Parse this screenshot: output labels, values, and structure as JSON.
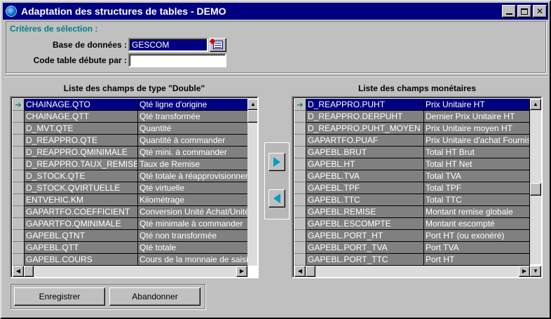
{
  "window": {
    "title": "Adaptation des structures de tables - DEMO",
    "min_glyph": "_",
    "max_glyph": "□",
    "close_glyph": "✕"
  },
  "criteria": {
    "title": "Critères de sélection :",
    "db_label": "Base de données :",
    "db_value": "GESCOM",
    "code_label": "Code table débute par :",
    "code_value": ""
  },
  "left_list": {
    "title": "Liste des champs de type \"Double\"",
    "selected_index": 0,
    "rows": [
      {
        "field": "CHAINAGE.QTO",
        "desc": "Qté ligne d'origine"
      },
      {
        "field": "CHAINAGE.QTT",
        "desc": "Qté transformée"
      },
      {
        "field": "D_MVT.QTE",
        "desc": "Quantité"
      },
      {
        "field": "D_REAPPRO.QTE",
        "desc": "Quantité à commander"
      },
      {
        "field": "D_REAPPRO.QMINIMALE",
        "desc": "Qté mini. à commander"
      },
      {
        "field": "D_REAPPRO.TAUX_REMISE",
        "desc": "Taux de Remise"
      },
      {
        "field": "D_STOCK.QTE",
        "desc": "Qté totale à réapprovisionner"
      },
      {
        "field": "D_STOCK.QVIRTUELLE",
        "desc": "Qté virtuelle"
      },
      {
        "field": "ENTVEHIC.KM",
        "desc": "Kilométrage"
      },
      {
        "field": "GAPARTFO.COEFFICIENT",
        "desc": "Conversion Unité Achat/Unité"
      },
      {
        "field": "GAPARTFO.QMINIMALE",
        "desc": "Qté minimale à commander"
      },
      {
        "field": "GAPEBL.QTNT",
        "desc": "Qté non transformée"
      },
      {
        "field": "GAPEBL.QTT",
        "desc": "Qté totale"
      },
      {
        "field": "GAPEBL.COURS",
        "desc": "Cours de la monnaie de saisie"
      }
    ]
  },
  "right_list": {
    "title": "Liste des champs monétaires",
    "selected_index": 0,
    "rows": [
      {
        "field": "D_REAPPRO.PUHT",
        "desc": "Prix Unitaire HT"
      },
      {
        "field": "D_REAPPRO.DERPUHT",
        "desc": "Dernier Prix Unitaire HT"
      },
      {
        "field": "D_REAPPRO.PUHT_MOYEN",
        "desc": "Prix Unitaire moyen HT"
      },
      {
        "field": "GAPARTFO.PUAF",
        "desc": "Prix Unitaire d'achat Fournisseur"
      },
      {
        "field": "GAPEBL.BRUT",
        "desc": "Total HT Brut"
      },
      {
        "field": "GAPEBL.HT",
        "desc": "Total HT Net"
      },
      {
        "field": "GAPEBL.TVA",
        "desc": "Total TVA"
      },
      {
        "field": "GAPEBL.TPF",
        "desc": "Total TPF"
      },
      {
        "field": "GAPEBL.TTC",
        "desc": "Total TTC"
      },
      {
        "field": "GAPEBL.REMISE",
        "desc": "Montant remise globale"
      },
      {
        "field": "GAPEBL.ESCOMPTE",
        "desc": "Montant escompté"
      },
      {
        "field": "GAPEBL.PORT_HT",
        "desc": "Port HT (ou exonéré)"
      },
      {
        "field": "GAPEBL.PORT_TVA",
        "desc": "Port TVA"
      },
      {
        "field": "GAPEBL.PORT_TTC",
        "desc": "Port HT"
      }
    ]
  },
  "buttons": {
    "save": "Enregistrer",
    "cancel": "Abandonner"
  },
  "icons": {
    "row_pointer": "arrow-right-icon",
    "move_right": "arrow-right-icon",
    "move_left": "arrow-left-icon"
  }
}
